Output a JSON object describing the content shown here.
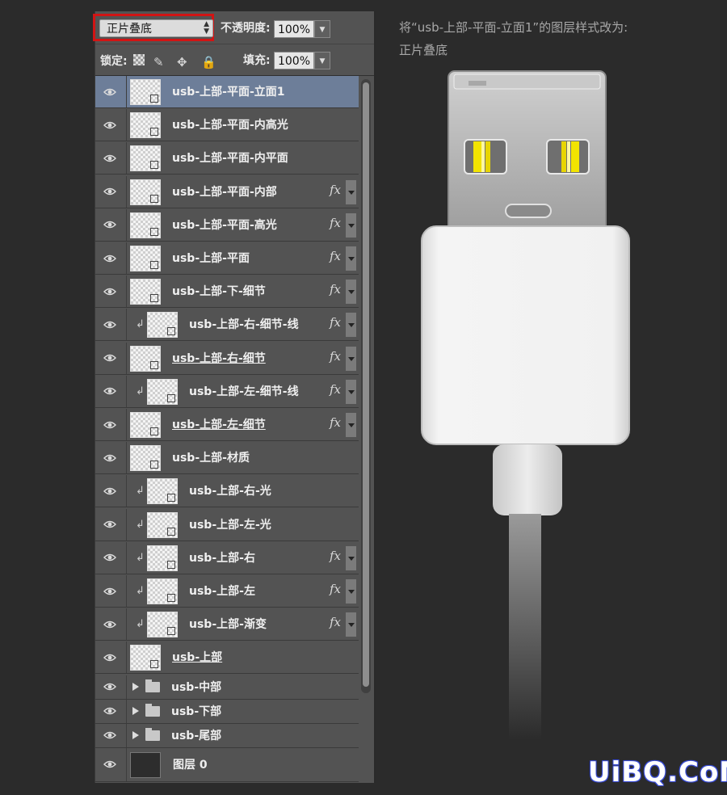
{
  "options": {
    "blend_mode": "正片叠底",
    "opacity_label": "不透明度:",
    "opacity_value": "100%",
    "lock_label": "锁定:",
    "fill_label": "填充:",
    "fill_value": "100%"
  },
  "layers": [
    {
      "name": "usb-上部-平面-立面1",
      "selected": true,
      "clipped": false,
      "fx": false,
      "underline": false
    },
    {
      "name": "usb-上部-平面-内高光",
      "clipped": false,
      "fx": false
    },
    {
      "name": "usb-上部-平面-内平面",
      "clipped": false,
      "fx": false
    },
    {
      "name": "usb-上部-平面-内部",
      "clipped": false,
      "fx": true
    },
    {
      "name": "usb-上部-平面-高光",
      "clipped": false,
      "fx": true
    },
    {
      "name": "usb-上部-平面",
      "clipped": false,
      "fx": true
    },
    {
      "name": "usb-上部-下-细节",
      "clipped": false,
      "fx": true
    },
    {
      "name": "usb-上部-右-细节-线",
      "clipped": true,
      "fx": true
    },
    {
      "name": "usb-上部-右-细节",
      "clipped": false,
      "fx": true,
      "underline": true
    },
    {
      "name": "usb-上部-左-细节-线",
      "clipped": true,
      "fx": true
    },
    {
      "name": "usb-上部-左-细节",
      "clipped": false,
      "fx": true,
      "underline": true
    },
    {
      "name": "usb-上部-材质",
      "clipped": false,
      "fx": false
    },
    {
      "name": "usb-上部-右-光",
      "clipped": true,
      "fx": false
    },
    {
      "name": "usb-上部-左-光",
      "clipped": true,
      "fx": false
    },
    {
      "name": "usb-上部-右",
      "clipped": true,
      "fx": true
    },
    {
      "name": "usb-上部-左",
      "clipped": true,
      "fx": true
    },
    {
      "name": "usb-上部-渐变",
      "clipped": true,
      "fx": true
    },
    {
      "name": "usb-上部",
      "clipped": false,
      "fx": false,
      "underline": true
    }
  ],
  "groups": [
    {
      "name": "usb-中部"
    },
    {
      "name": "usb-下部"
    },
    {
      "name": "usb-尾部"
    }
  ],
  "background_layer": {
    "name": "图层 0"
  },
  "caption": {
    "line1": "将“usb-上部-平面-立面1”的图层样式改为:",
    "line2": "正片叠底"
  },
  "watermark": "UiBQ.CoM",
  "colors": {
    "highlight_border": "#d21414",
    "selected_row": "#6d7e99",
    "panel_bg": "#535353",
    "page_bg": "#2b2b2b",
    "usb_pins": "#f2e400"
  }
}
